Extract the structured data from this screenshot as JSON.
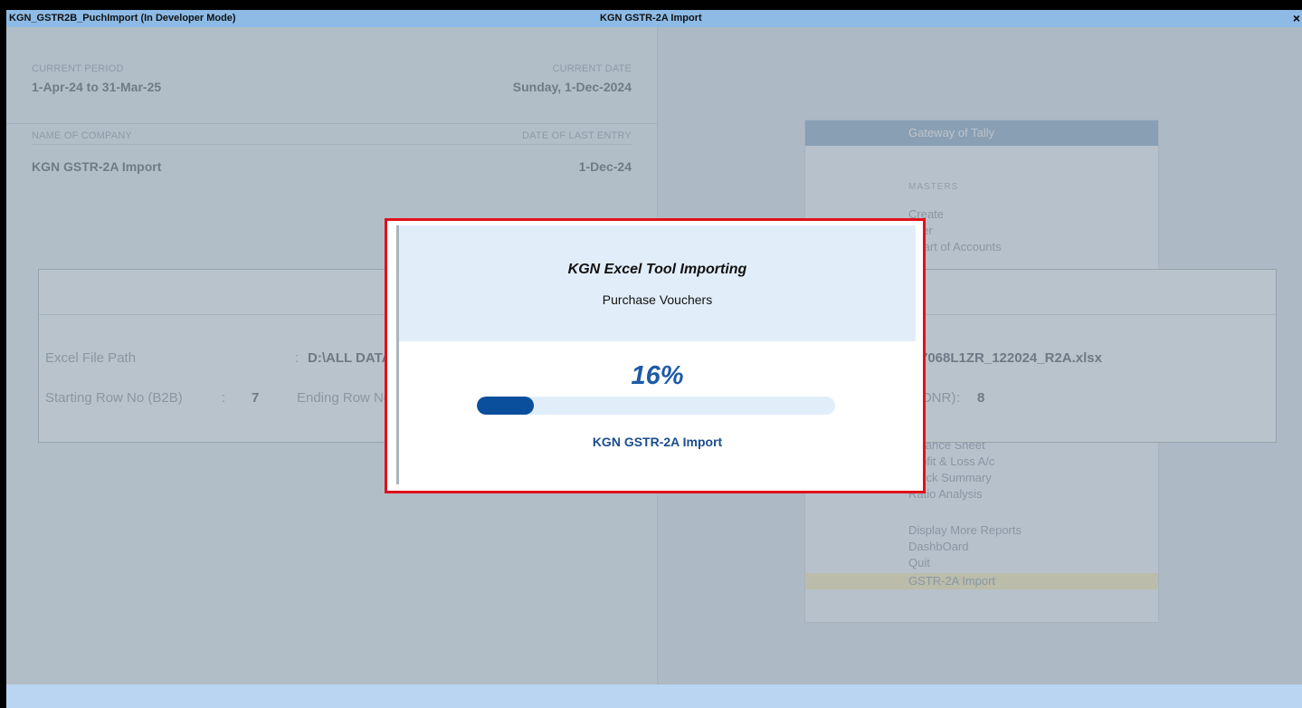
{
  "titlebar": {
    "left_text": "KGN_GSTR2B_PuchImport (In Developer Mode)",
    "center_text": "KGN GSTR-2A Import",
    "close": "×"
  },
  "company_info": {
    "current_period_label": "CURRENT PERIOD",
    "current_period_value": "1-Apr-24 to 31-Mar-25",
    "current_date_label": "CURRENT DATE",
    "current_date_value": "Sunday, 1-Dec-2024",
    "company_label": "NAME OF COMPANY",
    "last_entry_label": "DATE OF LAST ENTRY",
    "company_name": "KGN GSTR-2A Import",
    "last_entry_date": "1-Dec-24"
  },
  "gateway": {
    "title": "Gateway of Tally",
    "masters_label": "MASTERS",
    "masters_items": [
      "Create",
      "Alter",
      "Chart of Accounts"
    ],
    "reports_items": [
      "Balance Sheet",
      "Profit & Loss A/c",
      "Stock Summary",
      "Ratio Analysis"
    ],
    "more_items": [
      "Display More Reports",
      "DashbOard",
      "Quit",
      "GSTR-2A Import"
    ]
  },
  "import_form": {
    "excel_path_label": "Excel File Path",
    "excel_path_value_left": "D:\\ALL DATA",
    "excel_path_value_right": "7068L1ZR_122024_R2A.xlsx",
    "start_row_label": "Starting Row No (B2B)",
    "start_row_value": "7",
    "end_row_label": "Ending Row No",
    "cdnr_label": "(CDNR)",
    "cdnr_value": "8"
  },
  "progress_dialog": {
    "title": "KGN Excel Tool Importing",
    "subtitle": "Purchase Vouchers",
    "percent_text": "16%",
    "percent_value": 16,
    "app_name": "KGN GSTR-2A Import"
  },
  "colors": {
    "highlight_border": "#e0111b",
    "progress_fill": "#0a4f9b",
    "titlebar": "#8dbbe6"
  }
}
